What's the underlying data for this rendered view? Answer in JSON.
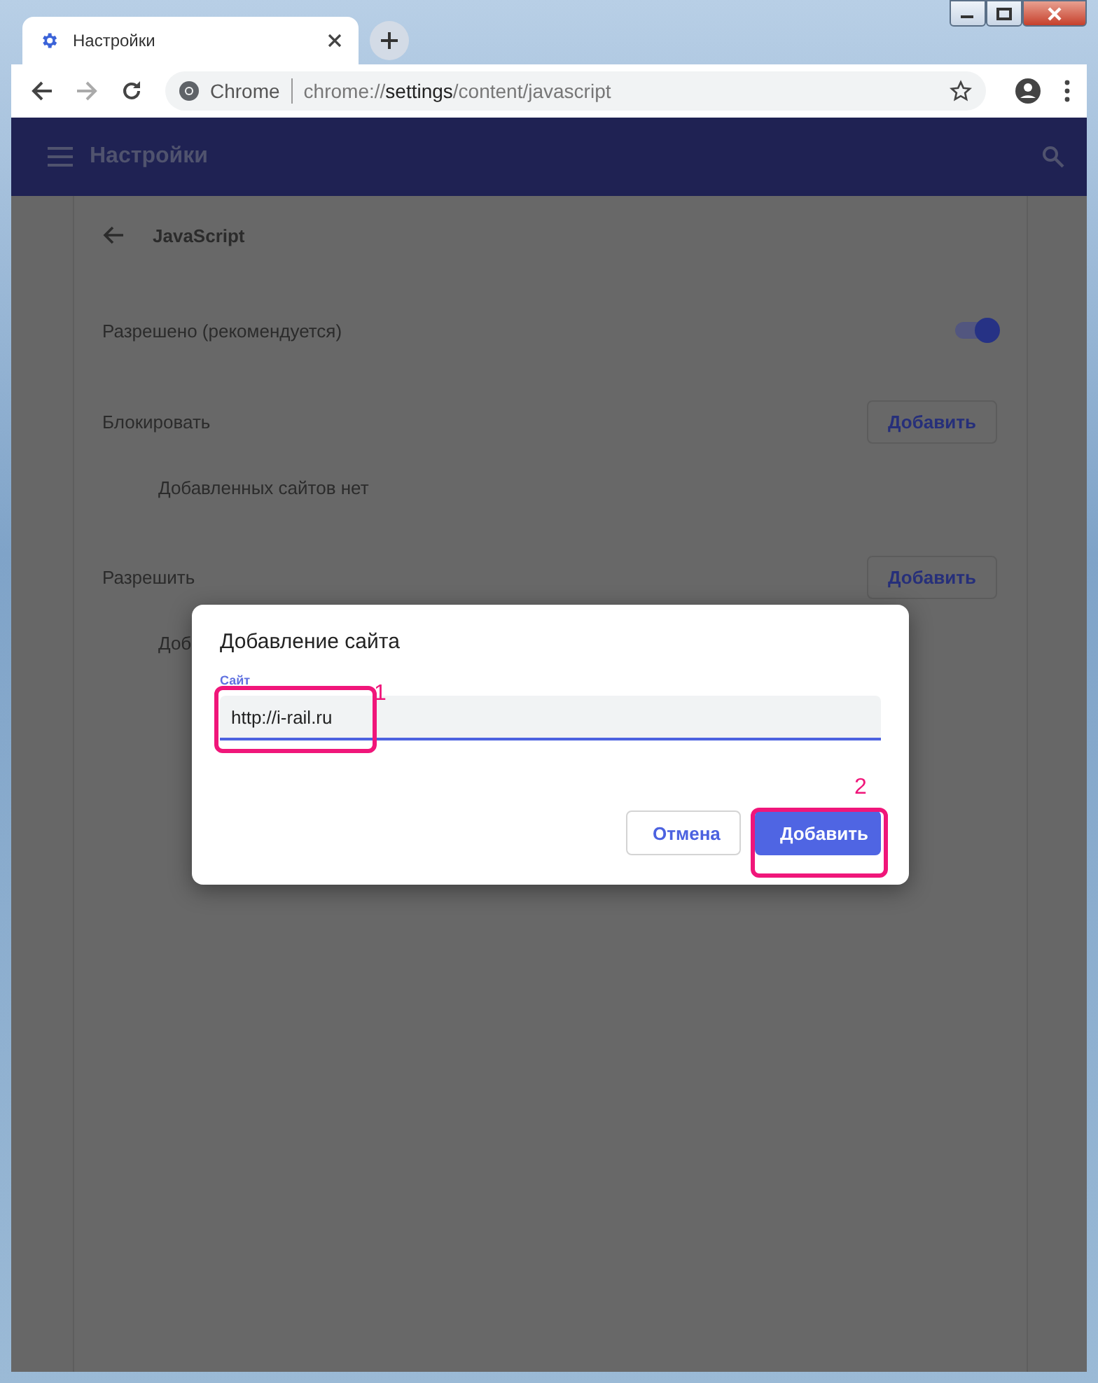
{
  "browser": {
    "tab": {
      "title": "Настройки"
    },
    "address_bar": {
      "site_label": "Chrome",
      "url_prefix": "chrome://",
      "url_host": "settings",
      "url_path": "/content/javascript"
    }
  },
  "header": {
    "title": "Настройки"
  },
  "page": {
    "title": "JavaScript",
    "toggle": {
      "label": "Разрешено (рекомендуется)",
      "on": true
    },
    "sections": [
      {
        "title": "Блокировать",
        "button": "Добавить",
        "empty_text": "Добавленных сайтов нет"
      },
      {
        "title": "Разрешить",
        "button": "Добавить",
        "empty_text": "Доб"
      }
    ]
  },
  "dialog": {
    "title": "Добавление сайта",
    "field": {
      "label": "Сайт",
      "value": "http://i-rail.ru"
    },
    "buttons": [
      {
        "label": "Отмена",
        "kind": "secondary"
      },
      {
        "label": "Добавить",
        "kind": "primary"
      }
    ]
  },
  "annotations": [
    {
      "label": "1"
    },
    {
      "label": "2"
    }
  ]
}
